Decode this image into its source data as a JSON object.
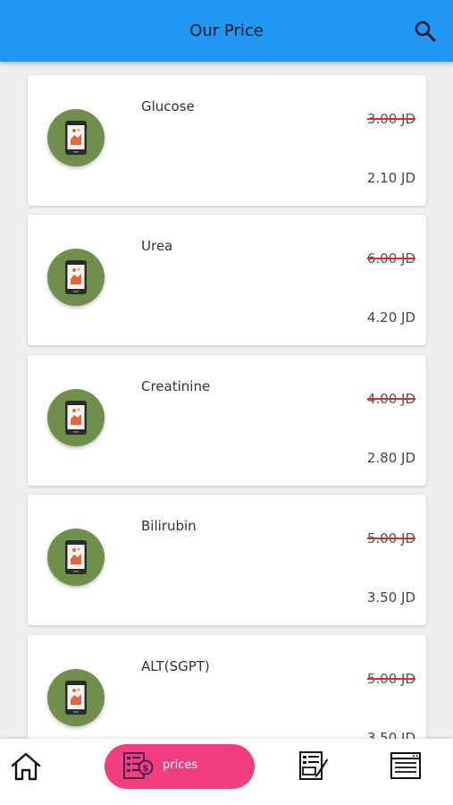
{
  "header": {
    "title": "Our Price",
    "search_icon": "search-icon"
  },
  "colors": {
    "appbar": "#2196f3",
    "active_tab": "#f23d7e",
    "thumb_bg": "#6f8f4a",
    "strike": "#d32f2f"
  },
  "tests": [
    {
      "name": "Glucose",
      "old_price": "3.00 JD",
      "new_price": "2.10 JD"
    },
    {
      "name": "Urea",
      "old_price": "6.00 JD",
      "new_price": "4.20 JD"
    },
    {
      "name": "Creatinine",
      "old_price": "4.00 JD",
      "new_price": "2.80 JD"
    },
    {
      "name": "Bilirubin",
      "old_price": "5.00 JD",
      "new_price": "3.50 JD"
    },
    {
      "name": "ALT(SGPT)",
      "old_price": "5.00 JD",
      "new_price": "3.50 JD"
    }
  ],
  "bottom_nav": {
    "items": [
      {
        "icon": "home-icon"
      },
      {
        "icon": "price-list-icon",
        "label": "prices",
        "active": true
      },
      {
        "icon": "order-form-icon"
      },
      {
        "icon": "news-icon"
      }
    ]
  }
}
